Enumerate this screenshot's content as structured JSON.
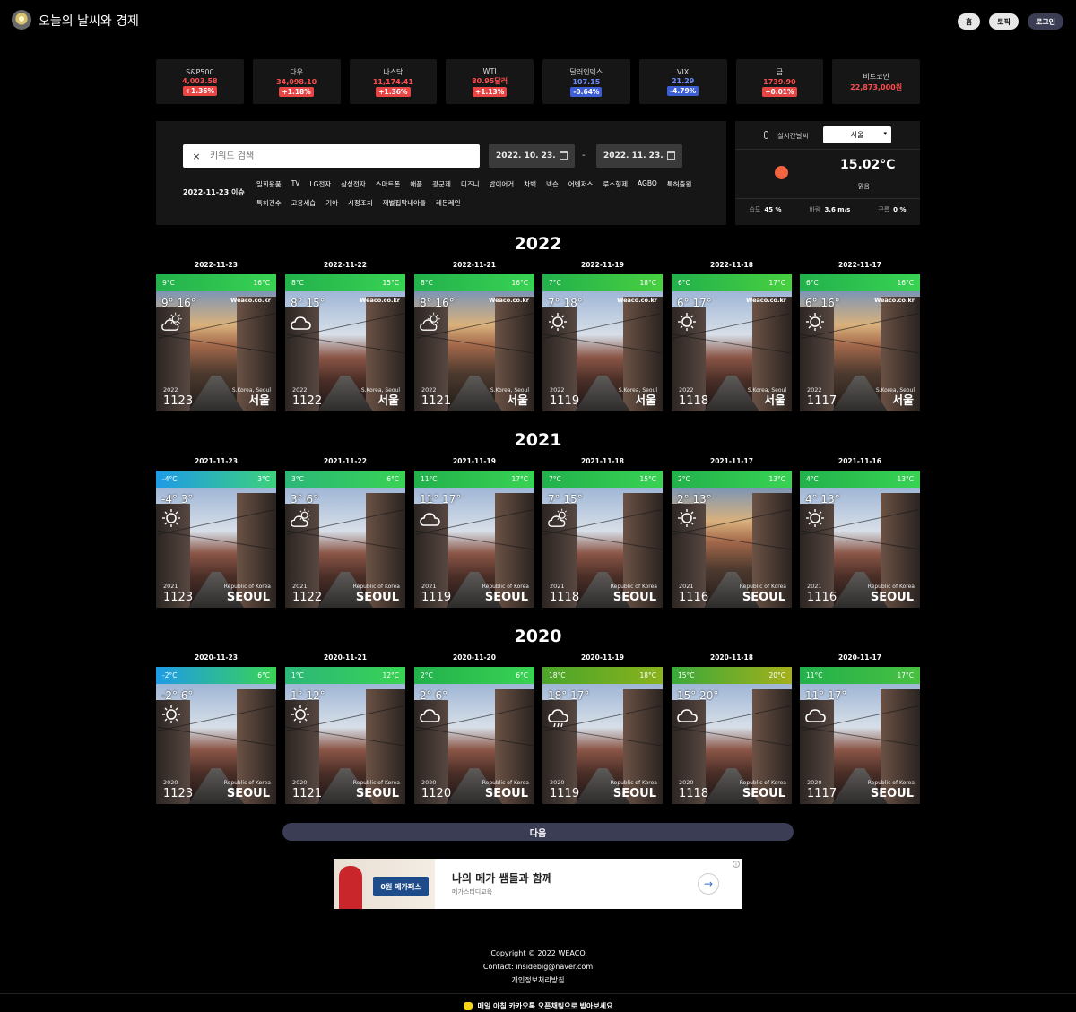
{
  "header": {
    "title": "오늘의 날씨와 경제",
    "nav": [
      "홈",
      "토픽",
      "로그인"
    ]
  },
  "tickers": [
    {
      "name": "S&P500",
      "value": "4,003.58",
      "change": "+1.36%",
      "dir": "up"
    },
    {
      "name": "다우",
      "value": "34,098.10",
      "change": "+1.18%",
      "dir": "up"
    },
    {
      "name": "나스닥",
      "value": "11,174.41",
      "change": "+1.36%",
      "dir": "up"
    },
    {
      "name": "WTI",
      "value": "80.95달러",
      "change": "+1.13%",
      "dir": "up"
    },
    {
      "name": "달러인덱스",
      "value": "107.15",
      "change": "-0.64%",
      "dir": "dn"
    },
    {
      "name": "VIX",
      "value": "21.29",
      "change": "-4.79%",
      "dir": "dn"
    },
    {
      "name": "금",
      "value": "1739.90",
      "change": "+0.01%",
      "dir": "up"
    },
    {
      "name": "비트코인",
      "value": "22,873,000원",
      "change": "",
      "dir": "flat"
    }
  ],
  "search": {
    "placeholder": "키워드 검색",
    "clear": "×",
    "date_from": "2022. 10. 23.",
    "date_to": "2022. 11. 23.",
    "dash": "-",
    "issue_label": "2022-11-23 이슈",
    "keywords": [
      "일회용품",
      "TV",
      "LG전자",
      "삼성전자",
      "스마트폰",
      "애플",
      "광군제",
      "디즈니",
      "밥이어거",
      "차백",
      "넥슨",
      "어벤저스",
      "루소형제",
      "AGBO",
      "특허출원",
      "특허건수",
      "고용세습",
      "기아",
      "시정조치",
      "재벌집막내아들",
      "레몬레인"
    ]
  },
  "weather": {
    "label": "실시간날씨",
    "city": "서울",
    "temp": "15.02°C",
    "sky": "맑음",
    "humidity_label": "습도",
    "humidity": "45 %",
    "wind_label": "바람",
    "wind": "3.6 m/s",
    "cloud_label": "구름",
    "cloud": "0 %"
  },
  "years": [
    {
      "year": "2022",
      "cards": [
        {
          "date": "2022-11-23",
          "lo": "9°C",
          "hi": "16°C",
          "temps": "9° 16°",
          "brand": "Weaco.co.kr",
          "loc": "S.Korea, Seoul",
          "yr": "2022",
          "md": "1123",
          "city": "서울",
          "icon": "sun-cloud-icon",
          "bar": "#22b14c",
          "bar2": "#39d353",
          "tone": "warm"
        },
        {
          "date": "2022-11-22",
          "lo": "8°C",
          "hi": "15°C",
          "temps": "8° 15°",
          "brand": "Weaco.co.kr",
          "loc": "S.Korea, Seoul",
          "yr": "2022",
          "md": "1122",
          "city": "서울",
          "icon": "cloud-icon",
          "bar": "#22b14c",
          "bar2": "#39d353",
          "tone": "cool"
        },
        {
          "date": "2022-11-21",
          "lo": "8°C",
          "hi": "16°C",
          "temps": "8° 16°",
          "brand": "Weaco.co.kr",
          "loc": "S.Korea, Seoul",
          "yr": "2022",
          "md": "1121",
          "city": "서울",
          "icon": "sun-cloud-icon",
          "bar": "#22b14c",
          "bar2": "#39d353",
          "tone": "warm"
        },
        {
          "date": "2022-11-19",
          "lo": "7°C",
          "hi": "18°C",
          "temps": "7° 18°",
          "brand": "Weaco.co.kr",
          "loc": "S.Korea, Seoul",
          "yr": "2022",
          "md": "1119",
          "city": "서울",
          "icon": "sun-icon",
          "bar": "#22b14c",
          "bar2": "#48d040",
          "tone": "cool"
        },
        {
          "date": "2022-11-18",
          "lo": "6°C",
          "hi": "17°C",
          "temps": "6° 17°",
          "brand": "Weaco.co.kr",
          "loc": "S.Korea, Seoul",
          "yr": "2022",
          "md": "1118",
          "city": "서울",
          "icon": "sun-icon",
          "bar": "#22b14c",
          "bar2": "#48d040",
          "tone": "cool"
        },
        {
          "date": "2022-11-17",
          "lo": "6°C",
          "hi": "16°C",
          "temps": "6° 16°",
          "brand": "Weaco.co.kr",
          "loc": "S.Korea, Seoul",
          "yr": "2022",
          "md": "1117",
          "city": "서울",
          "icon": "sun-icon",
          "bar": "#22b14c",
          "bar2": "#39d353",
          "tone": "warm"
        }
      ]
    },
    {
      "year": "2021",
      "cards": [
        {
          "date": "2021-11-23",
          "lo": "-4°C",
          "hi": "3°C",
          "temps": "-4° 3°",
          "brand": "",
          "loc": "Republic of Korea",
          "yr": "2021",
          "md": "1123",
          "city": "SEOUL",
          "icon": "sun-icon",
          "bar": "#1e9be8",
          "bar2": "#3dd17a",
          "tone": "cool"
        },
        {
          "date": "2021-11-22",
          "lo": "3°C",
          "hi": "6°C",
          "temps": "3° 6°",
          "brand": "",
          "loc": "Republic of Korea",
          "yr": "2021",
          "md": "1122",
          "city": "SEOUL",
          "icon": "sun-cloud-icon",
          "bar": "#2bb77a",
          "bar2": "#39d353",
          "tone": "cool"
        },
        {
          "date": "2021-11-19",
          "lo": "11°C",
          "hi": "17°C",
          "temps": "11° 17°",
          "brand": "",
          "loc": "Republic of Korea",
          "yr": "2021",
          "md": "1119",
          "city": "SEOUL",
          "icon": "cloud-icon",
          "bar": "#22b14c",
          "bar2": "#39d353",
          "tone": "cool"
        },
        {
          "date": "2021-11-18",
          "lo": "7°C",
          "hi": "15°C",
          "temps": "7° 15°",
          "brand": "",
          "loc": "Republic of Korea",
          "yr": "2021",
          "md": "1118",
          "city": "SEOUL",
          "icon": "sun-cloud-icon",
          "bar": "#22b14c",
          "bar2": "#39d353",
          "tone": "cool"
        },
        {
          "date": "2021-11-17",
          "lo": "2°C",
          "hi": "13°C",
          "temps": "2° 13°",
          "brand": "",
          "loc": "Republic of Korea",
          "yr": "2021",
          "md": "1116",
          "city": "SEOUL",
          "icon": "sun-icon",
          "bar": "#22b14c",
          "bar2": "#39d353",
          "tone": "warm"
        },
        {
          "date": "2021-11-16",
          "lo": "4°C",
          "hi": "13°C",
          "temps": "4° 13°",
          "brand": "",
          "loc": "Republic of Korea",
          "yr": "2021",
          "md": "1116",
          "city": "SEOUL",
          "icon": "sun-icon",
          "bar": "#22b14c",
          "bar2": "#39d353",
          "tone": "cool"
        }
      ]
    },
    {
      "year": "2020",
      "cards": [
        {
          "date": "2020-11-23",
          "lo": "-2°C",
          "hi": "6°C",
          "temps": "-2° 6°",
          "brand": "",
          "loc": "Republic of Korea",
          "yr": "2020",
          "md": "1123",
          "city": "SEOUL",
          "icon": "sun-icon",
          "bar": "#1e9be8",
          "bar2": "#39d353",
          "tone": "cool"
        },
        {
          "date": "2020-11-21",
          "lo": "1°C",
          "hi": "12°C",
          "temps": "1° 12°",
          "brand": "",
          "loc": "Republic of Korea",
          "yr": "2020",
          "md": "1121",
          "city": "SEOUL",
          "icon": "sun-icon",
          "bar": "#2bb77a",
          "bar2": "#39d353",
          "tone": "cool"
        },
        {
          "date": "2020-11-20",
          "lo": "2°C",
          "hi": "6°C",
          "temps": "2° 6°",
          "brand": "",
          "loc": "Republic of Korea",
          "yr": "2020",
          "md": "1120",
          "city": "SEOUL",
          "icon": "cloud-icon",
          "bar": "#22b14c",
          "bar2": "#39d353",
          "tone": "cool"
        },
        {
          "date": "2020-11-19",
          "lo": "18°C",
          "hi": "18°C",
          "temps": "18° 17°",
          "brand": "",
          "loc": "Republic of Korea",
          "yr": "2020",
          "md": "1119",
          "city": "SEOUL",
          "icon": "rain-icon",
          "bar": "#4aa52a",
          "bar2": "#8ab21d",
          "tone": "cool"
        },
        {
          "date": "2020-11-18",
          "lo": "15°C",
          "hi": "20°C",
          "temps": "15° 20°",
          "brand": "",
          "loc": "Republic of Korea",
          "yr": "2020",
          "md": "1118",
          "city": "SEOUL",
          "icon": "cloud-icon",
          "bar": "#3aa93a",
          "bar2": "#a4b01a",
          "tone": "cool"
        },
        {
          "date": "2020-11-17",
          "lo": "11°C",
          "hi": "17°C",
          "temps": "11° 17°",
          "brand": "",
          "loc": "Republic of Korea",
          "yr": "2020",
          "md": "1117",
          "city": "SEOUL",
          "icon": "cloud-icon",
          "bar": "#22b14c",
          "bar2": "#48c040",
          "tone": "cool"
        }
      ]
    }
  ],
  "next_label": "다음",
  "ad": {
    "title": "나의 메가 쌤들과 함께",
    "sub": "메가스터디교육",
    "badge": "0원 메가패스",
    "arrow": "→",
    "info": "i"
  },
  "footer": {
    "copyright": "Copyright © 2022 WEACO",
    "contact": "Contact: insidebig@naver.com",
    "privacy": "개인정보처리방침"
  },
  "kakao": "매일 아침 카카오톡 오픈채팅으로 받아보세요"
}
